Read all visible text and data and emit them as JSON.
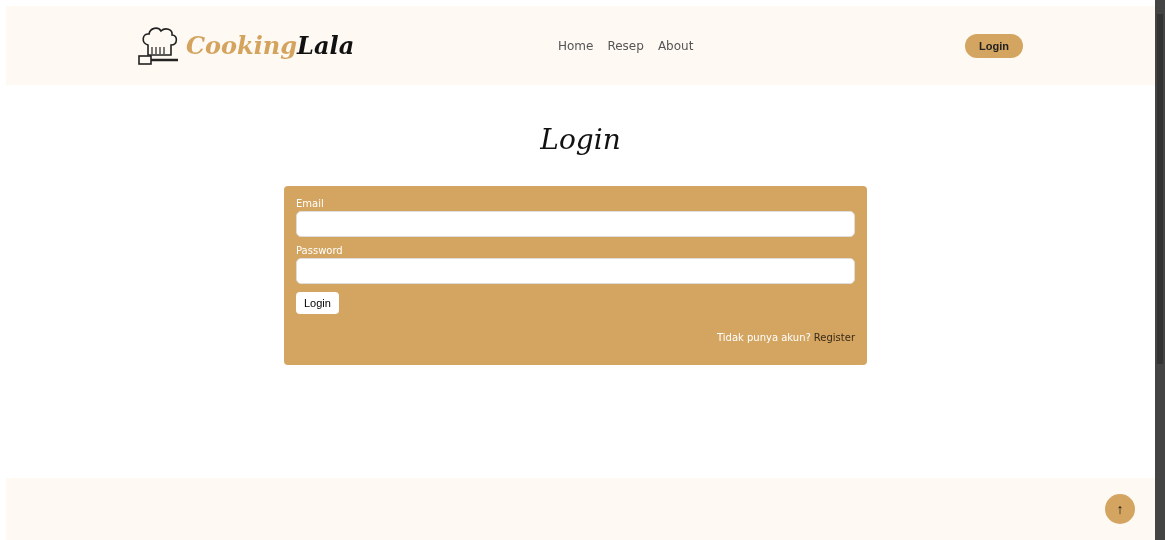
{
  "header": {
    "logo": {
      "part_1": "Cooking",
      "part_2": "Lala"
    },
    "nav": [
      {
        "label": "Home"
      },
      {
        "label": "Resep"
      },
      {
        "label": "About"
      }
    ],
    "login_button": "Login"
  },
  "page_title": "Login",
  "form": {
    "fields": [
      {
        "label": "Email"
      },
      {
        "label": "Password"
      }
    ],
    "submit": "Login",
    "register_prompt": "Tidak punya akun?",
    "register_link": "Register"
  },
  "back_to_top": "↑"
}
